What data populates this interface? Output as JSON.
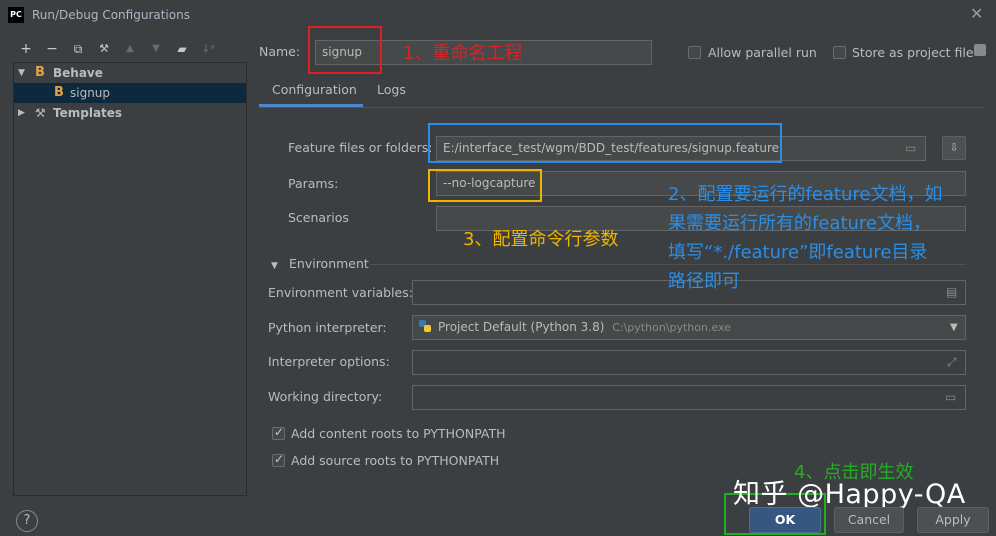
{
  "window": {
    "title": "Run/Debug Configurations",
    "logo_text": "PC"
  },
  "toolbar": {
    "add": "+",
    "remove": "−",
    "copy": "⧉",
    "edit": "🔧",
    "up": "▲",
    "down": "▼",
    "folder": "📁",
    "sort": "↓ᵃ"
  },
  "tree": {
    "items": [
      {
        "label": "Behave",
        "icon": "B"
      },
      {
        "label": "signup",
        "icon": "B"
      },
      {
        "label": "Templates"
      }
    ]
  },
  "header": {
    "name_label": "Name:",
    "name_value": "signup",
    "allow_parallel": "Allow parallel run",
    "store_project": "Store as project file"
  },
  "tabs": [
    "Configuration",
    "Logs"
  ],
  "config": {
    "feature_label": "Feature files or folders:",
    "feature_value": "E:/interface_test/wgm/BDD_test/features/signup.feature",
    "params_label": "Params:",
    "params_value": "--no-logcapture",
    "scenarios_label": "Scenarios",
    "environment_label": "Environment",
    "env_vars_label": "Environment variables:",
    "interpreter_label": "Python interpreter:",
    "interpreter_value": "Project Default (Python 3.8)",
    "interpreter_path": "C:\\python\\python.exe",
    "interp_options_label": "Interpreter options:",
    "working_dir_label": "Working directory:",
    "add_content_roots": "Add content roots to PYTHONPATH",
    "add_source_roots": "Add source roots to PYTHONPATH"
  },
  "annotations": {
    "a1": "1、重命名工程",
    "a2_line1": "2、配置要运行的feature文档，如",
    "a2_line2": "果需要运行所有的feature文档，",
    "a2_line3": "填写“*./feature”即feature目录",
    "a2_line4": "路径即可",
    "a3": "3、配置命令行参数",
    "a4": "4、点击即生效"
  },
  "buttons": {
    "ok": "OK",
    "cancel": "Cancel",
    "apply": "Apply",
    "help": "?"
  },
  "watermark": "知乎 @Happy-QA",
  "colors": {
    "red": "#e02020",
    "blue": "#2a8ee8",
    "yellow": "#f0b400",
    "green": "#22b022"
  }
}
